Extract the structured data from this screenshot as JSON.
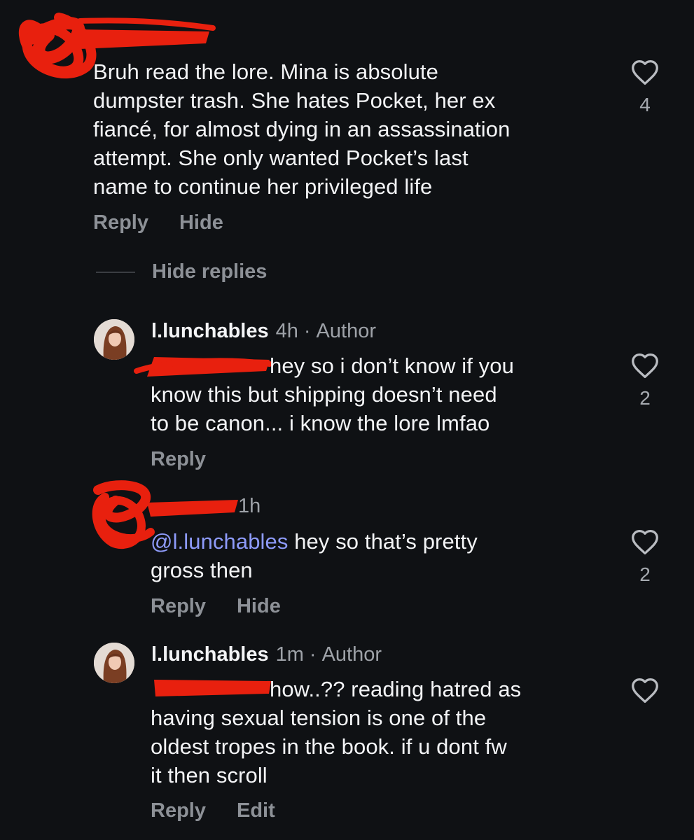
{
  "comments": [
    {
      "text": "Bruh read the lore. Mina is absolute\ndumpster trash. She hates Pocket, her ex\nfiancé, for almost dying in an assassination\nattempt. She only wanted Pocket’s last\nname to continue her privileged life",
      "actions": [
        "Reply",
        "Hide"
      ],
      "like_count": "4"
    },
    {
      "username": "l.lunchables",
      "time": "4h",
      "separator": "·",
      "badge": "Author",
      "text": "hey so i don’t know if you\nknow this but shipping doesn’t need\nto be canon... i know the lore lmfao",
      "actions": [
        "Reply"
      ],
      "like_count": "2"
    },
    {
      "time": "1h",
      "mention": "@l.lunchables",
      "text": " hey so that’s pretty\ngross then",
      "actions": [
        "Reply",
        "Hide"
      ],
      "like_count": "2"
    },
    {
      "username": "l.lunchables",
      "time": "1m",
      "separator": "·",
      "badge": "Author",
      "text": "how..?? reading hatred as\nhaving sexual tension is one of the\noldest tropes in the book. if u dont fw\nit then scroll",
      "actions": [
        "Reply",
        "Edit"
      ],
      "like_count": ""
    }
  ],
  "hide_replies_label": "Hide replies",
  "colors": {
    "background": "#0f1114",
    "text": "#f3f4f6",
    "muted": "#8d9197",
    "mention": "#8e9bfa",
    "redaction": "#e8200e"
  },
  "icons": [
    "heart-icon",
    "avatar",
    "redaction-scribble"
  ]
}
